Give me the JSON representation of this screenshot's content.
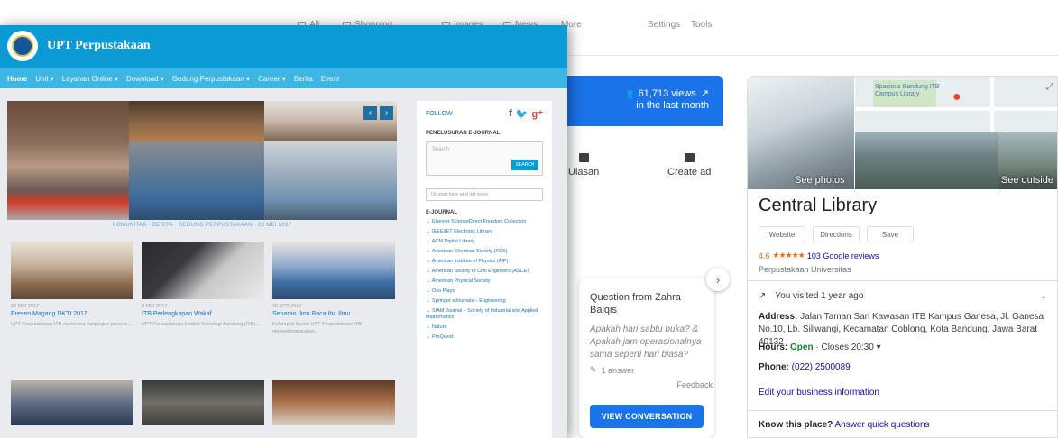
{
  "google": {
    "tabs": [
      {
        "label": "All",
        "icon": "search-icon"
      },
      {
        "label": "Shopping",
        "icon": "tag-icon"
      },
      {
        "label": "Images",
        "icon": "image-icon"
      },
      {
        "label": "News",
        "icon": "news-icon"
      },
      {
        "label": "More",
        "icon": "more-icon"
      }
    ],
    "settings_label": "Settings",
    "tools_label": "Tools",
    "stats": {
      "views_text": "61,713 views",
      "period_text": "in the last month",
      "actions": [
        {
          "label": "Ulasan",
          "icon": "review-icon"
        },
        {
          "label": "Create ad",
          "icon": "ad-icon"
        }
      ],
      "question": {
        "title": "Question from Zahra Balqis",
        "body": "Apakah hari sabtu buka? & Apakah jam operasionalnya sama seperti hari biasa?",
        "meta": "1 answer",
        "button": "VIEW CONVERSATION"
      },
      "feedback": "Feedback"
    },
    "knowledge_panel": {
      "map_label": "Spacious Bandung ITB Campus Library",
      "see_photos": "See photos",
      "see_outside": "See outside",
      "title": "Central Library",
      "buttons": [
        "Website",
        "Directions",
        "Save"
      ],
      "rating": "4.6",
      "stars": "★★★★★",
      "reviews": "103 Google reviews",
      "category": "Perpustakaan Universitas",
      "visited": "You visited 1 year ago",
      "address_label": "Address:",
      "address": "Jalan Taman Sari Kawasan ITB Kampus Ganesa, Jl. Ganesa No.10, Lb. Siliwangi, Kecamatan Coblong, Kota Bandung, Jawa Barat 40132",
      "hours_label": "Hours:",
      "hours_status": "Open",
      "hours_text": "· Closes 20:30 ▾",
      "phone_label": "Phone:",
      "phone": "(022) 2500089",
      "edit_info": "Edit your business information",
      "know_label": "Know this place?",
      "know_link": "Answer quick questions"
    }
  },
  "upt": {
    "title": "UPT Perpustakaan",
    "nav": [
      "Home",
      "Unit ▾",
      "Layanan Online ▾",
      "Download ▾",
      "Gedung Perpustakaan ▾",
      "Career ▾",
      "Berita",
      "Event"
    ],
    "breadcrumb": "KOMUNITAS · BERITA · GEDUNG PERPUSTAKAAN · 23 MEI 2017",
    "cards": [
      {
        "date": "23 MEI 2017",
        "title": "Eresen Magang DKTI 2017",
        "excerpt": "UPT Perpustakaan ITB menerima kunjungan peserta..."
      },
      {
        "date": "8 MEI 2017",
        "title": "ITB Perlengkapan Wakaf",
        "excerpt": "UPT Perpustakaan Institut Teknologi Bandung (ITB)..."
      },
      {
        "date": "20 APR 2017",
        "title": "Sebaran Ilmu Baca Ibu Ilmu",
        "excerpt": "Kelompok bersin UPT Perpustakaan ITB menyelenggarakan..."
      }
    ],
    "sidebar": {
      "follow": "FOLLOW",
      "search_heading": "PENELUSURAN E-JOURNAL",
      "search_placeholder": "Search",
      "search_button": "SEARCH",
      "filter_placeholder": "Or start type and list more",
      "journal_heading": "E-JOURNAL",
      "journals": [
        "Elsevier ScienceDirect Freedom Collection",
        "IEEE/IET Electronic Library",
        "ACM Digital Library",
        "American Chemical Society (ACS)",
        "American Institute of Physics (AIP)",
        "American Society of Civil Engineers (ASCE)",
        "American Physical Society",
        "Oxo Plays",
        "Springer eJournals – Engineering",
        "SIAM Journal – Society of Industrial and Applied Mathematics",
        "Nature",
        "ProQuest"
      ]
    }
  }
}
